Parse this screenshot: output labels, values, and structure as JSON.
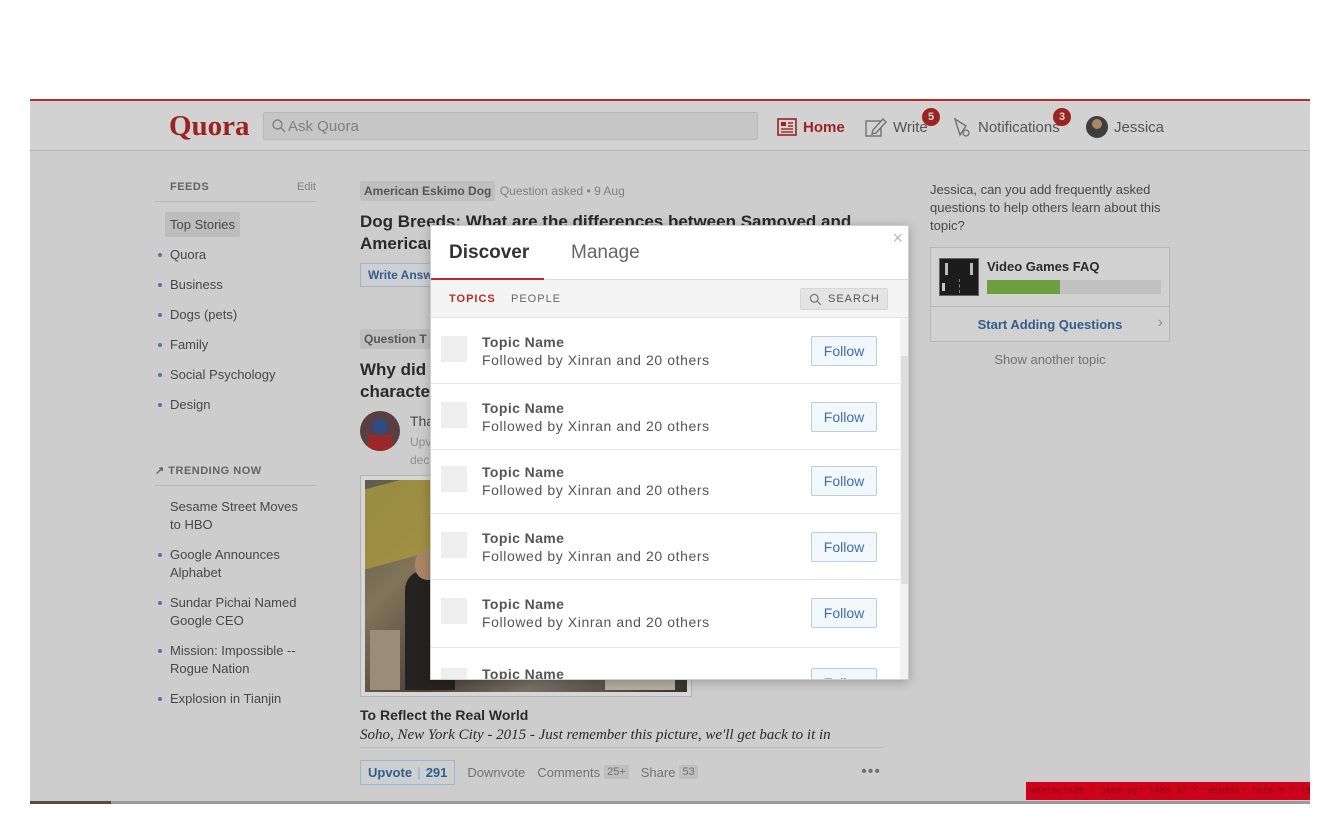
{
  "header": {
    "logo": "Quora",
    "search_placeholder": "Ask Quora",
    "nav": {
      "home": "Home",
      "write": "Write",
      "write_badge": "5",
      "notifications": "Notifications",
      "notifications_badge": "3",
      "user": "Jessica"
    }
  },
  "sidebar": {
    "feeds_title": "FEEDS",
    "edit": "Edit",
    "feeds": [
      "Top Stories",
      "Quora",
      "Business",
      "Dogs (pets)",
      "Family",
      "Social Psychology",
      "Design"
    ],
    "trending_title": "TRENDING NOW",
    "trending": [
      "Sesame Street Moves to HBO",
      "Google Announces Alphabet",
      "Sundar Pichai Named Google CEO",
      "Mission: Impossible -- Rogue Nation",
      "Explosion in Tianjin"
    ]
  },
  "feed": {
    "item1": {
      "tag": "American Eskimo Dog",
      "meta": "Question asked • 9 Aug",
      "title": "Dog Breeds: What are the differences between Samoyed and American",
      "write_answer": "Write Answer"
    },
    "item2": {
      "tag": "Question T",
      "title": "Why did",
      "title2": "characte",
      "author_frag": "Tha",
      "meta_frag": "Upv",
      "meta_frag2": "dec"
    },
    "answer_title": "To Reflect the Real World",
    "answer_quote": "Soho, New York City - 2015 - Just remember this picture, we'll get back to it in",
    "actions": {
      "upvote": "Upvote",
      "upvote_count": "291",
      "downvote": "Downvote",
      "comments": "Comments",
      "comments_count": "25+",
      "share": "Share",
      "share_count": "53",
      "more": "•••"
    }
  },
  "right": {
    "prompt": "Jessica, can you add frequently asked questions to help others learn about this topic?",
    "faq_title": "Video Games FAQ",
    "faq_progress": 0.42,
    "start": "Start Adding Questions",
    "show_another": "Show another topic"
  },
  "modal": {
    "close": "×",
    "tabs": [
      "Discover",
      "Manage"
    ],
    "subtabs": [
      "TOPICS",
      "PEOPLE"
    ],
    "search": "SEARCH",
    "rows": [
      {
        "name": "Topic Name",
        "sub": "Followed by Xinran and 20 others",
        "button": "Follow"
      },
      {
        "name": "Topic Name",
        "sub": "Followed by Xinran and 20 others",
        "button": "Follow"
      },
      {
        "name": "Topic Name",
        "sub": "Followed by Xinran and 20 others",
        "button": "Follow"
      },
      {
        "name": "Topic Name",
        "sub": "Followed by Xinran and 20 others",
        "button": "Follow"
      },
      {
        "name": "Topic Name",
        "sub": "Followed by Xinran and 20 others",
        "button": "Follow"
      },
      {
        "name": "Topic Name",
        "sub": "",
        "button": "Follow"
      }
    ]
  },
  "debug": "webtools28 / page.py: 1485.37 / request: 1516.8 / load: 1712.5",
  "colors": {
    "brand": "#b92b27",
    "link": "#3e6fa6",
    "progress": "#7fbf4d"
  }
}
